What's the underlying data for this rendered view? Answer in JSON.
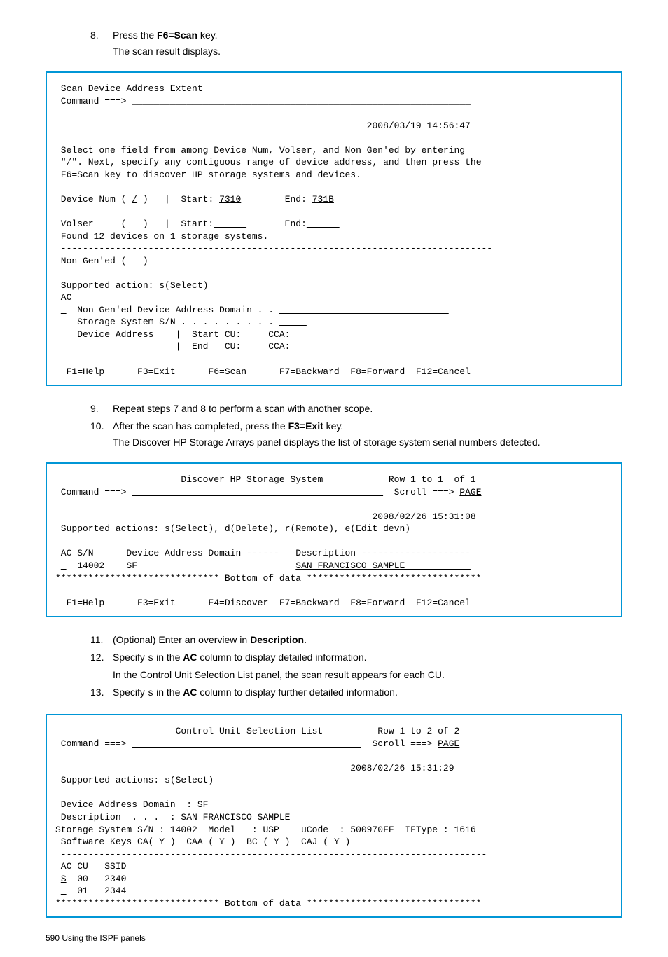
{
  "steps_a": [
    {
      "num": "8.",
      "html": "Press the <span class='bold'>F6=Scan</span> key.",
      "sub": "The scan result displays."
    }
  ],
  "term1": " Scan Device Address Extent\n Command ===> ______________________________________________________________\n\n                                                         2008/03/19 14:56:47\n\n Select one field from among Device Num, Volser, and Non Gen'ed by entering\n \"/\". Next, specify any contiguous range of device address, and then press the\n F6=Scan key to discover HP storage systems and devices.\n\n Device Num ( <span class='u'>/</span> )   |  Start: <span class='u'>7310</span>        End: <span class='u'>731B</span>\n\n Volser     (   )   |  Start:<span class='u'>      </span>       End:<span class='u'>      </span>\n Found 12 devices on 1 storage systems.\n -------------------------------------------------------------------------------\n Non Gen'ed (   )\n\n Supported action: s(Select)\n AC\n <span class='u'> </span>  Non Gen'ed Device Address Domain . . <span class='u'>                               </span>\n    Storage System S/N . . . . . . . . . <span class='u'>     </span>\n    Device Address    |  Start CU: <span class='u'>  </span>  CCA: <span class='u'>  </span>\n                      |  End   CU: <span class='u'>  </span>  CCA: <span class='u'>  </span>\n\n  F1=Help      F3=Exit      F6=Scan      F7=Backward  F8=Forward  F12=Cancel",
  "steps_b": [
    {
      "num": "9.",
      "html": "Repeat steps 7 and 8 to perform a scan with another scope."
    },
    {
      "num": "10.",
      "html": "After the scan has completed, press the <span class='bold'>F3=Exit</span> key.",
      "sub": "The Discover HP Storage Arrays panel displays the list of storage system serial numbers detected."
    }
  ],
  "term2": "                       Discover HP Storage System            Row 1 to 1  of 1\n Command ===> <span class='u'>                                              </span>  Scroll ===> <span class='u'>PAGE</span>\n\n                                                          2008/02/26 15:31:08\n Supported actions: s(Select), d(Delete), r(Remote), e(Edit devn)\n\n AC S/N      Device Address Domain ------   Description --------------------\n <span class='u'> </span>  14002    SF                             <span class='u'>SAN FRANCISCO SAMPLE            </span>\n****************************** Bottom of data ********************************\n\n  F1=Help      F3=Exit      F4=Discover  F7=Backward  F8=Forward  F12=Cancel",
  "steps_c": [
    {
      "num": "11.",
      "html": "(Optional) Enter an overview in <span class='bold'>Description</span>."
    },
    {
      "num": "12.",
      "html": "Specify <span class='mono'>s</span> in the <span class='bold'>AC</span> column to display detailed information.",
      "sub": "In the Control Unit Selection List panel, the scan result appears for each CU."
    },
    {
      "num": "13.",
      "html": "Specify <span class='mono'>s</span> in the <span class='bold'>AC</span> column to display further detailed information."
    }
  ],
  "term3": "                      Control Unit Selection List          Row 1 to 2 of 2\n Command ===> <span class='u'>                                          </span>  Scroll ===> <span class='u'>PAGE</span>\n\n                                                      2008/02/26 15:31:29\n Supported actions: s(Select)\n\n Device Address Domain  : SF\n Description  . . .  : SAN FRANCISCO SAMPLE\nStorage System S/N : 14002  Model   : USP    uCode  : 500970FF  IFType : 1616\n Software Keys CA( Y )  CAA ( Y )  BC ( Y )  CAJ ( Y )\n ------------------------------------------------------------------------------\n AC CU   SSID\n <span class='u'>S</span>  00   2340\n <span class='u'> </span>  01   2344\n****************************** Bottom of data ********************************",
  "footer": "590   Using the ISPF panels"
}
